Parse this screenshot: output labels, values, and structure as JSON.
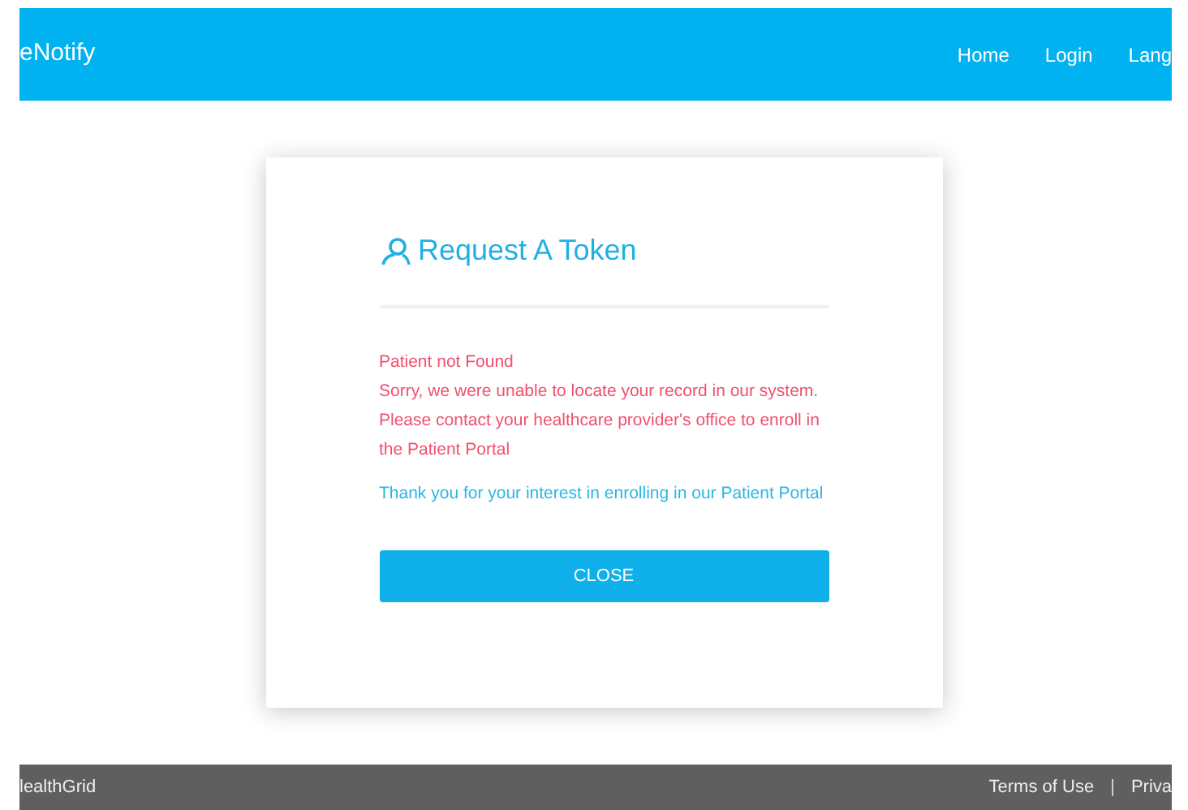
{
  "navbar": {
    "brand": "eNotify",
    "links": [
      {
        "label": "Home"
      },
      {
        "label": "Login"
      },
      {
        "label": "Lang"
      }
    ]
  },
  "dialog": {
    "title": "Request A Token",
    "error_title": "Patient not Found",
    "error_message": "Sorry, we were unable to locate your record in our system. Please contact your healthcare provider's office to enroll in the Patient Portal",
    "info_message": "Thank you for your interest in enrolling in our Patient Portal",
    "button": "CLOSE"
  },
  "footer": {
    "brand": "lealthGrid",
    "links": [
      {
        "label": "Terms of Use"
      },
      {
        "label": "Priva"
      }
    ],
    "separator": "|"
  }
}
